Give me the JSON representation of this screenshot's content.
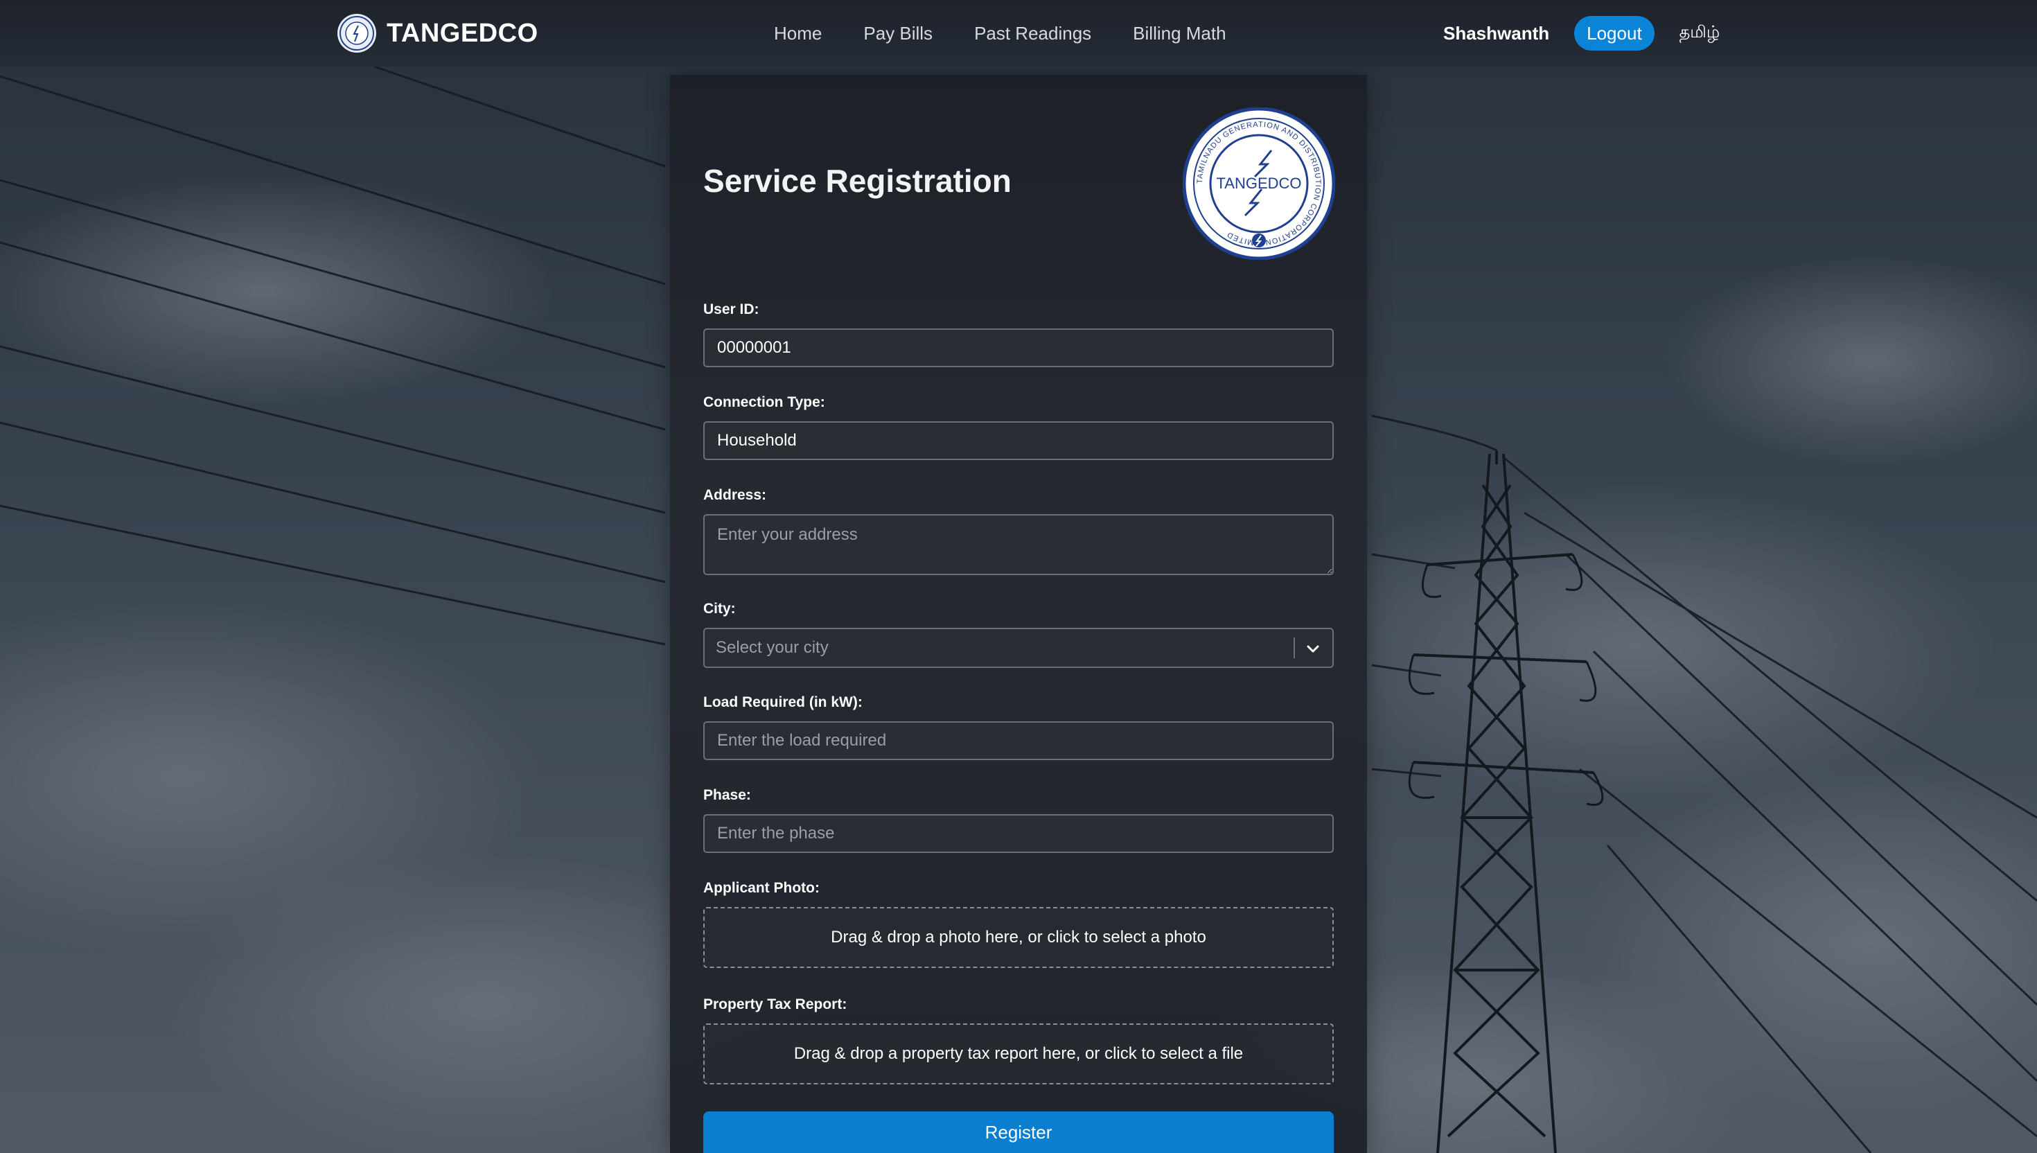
{
  "navbar": {
    "brand": "TANGEDCO",
    "links": [
      "Home",
      "Pay Bills",
      "Past Readings",
      "Billing Math"
    ],
    "user_name": "Shashwanth",
    "logout_label": "Logout",
    "language_label": "தமிழ்"
  },
  "form": {
    "title": "Service Registration",
    "seal": {
      "center_text": "TANGEDCO",
      "ring_text": "TAMILNADU GENERATION AND DISTRIBUTION CORPORATION LIMITED"
    },
    "user_id": {
      "label": "User ID:",
      "value": "00000001"
    },
    "connection_type": {
      "label": "Connection Type:",
      "value": "Household"
    },
    "address": {
      "label": "Address:",
      "placeholder": "Enter your address"
    },
    "city": {
      "label": "City:",
      "placeholder": "Select your city"
    },
    "load": {
      "label": "Load Required (in kW):",
      "placeholder": "Enter the load required"
    },
    "phase": {
      "label": "Phase:",
      "placeholder": "Enter the phase"
    },
    "applicant_photo": {
      "label": "Applicant Photo:",
      "dropzone_text": "Drag & drop a photo here, or click to select a photo"
    },
    "property_tax": {
      "label": "Property Tax Report:",
      "dropzone_text": "Drag & drop a property tax report here, or click to select a file"
    },
    "register_label": "Register"
  },
  "colors": {
    "accent": "#0a84d6",
    "navbar_bg": "#1d222b",
    "card_bg": "#24272e",
    "input_bg": "#2a2d33",
    "seal_blue": "#1f3f8f"
  },
  "icons": {
    "brand": "tangedco-logo-icon",
    "seal": "tangedco-seal-icon",
    "city_dropdown": "chevron-down-icon"
  }
}
